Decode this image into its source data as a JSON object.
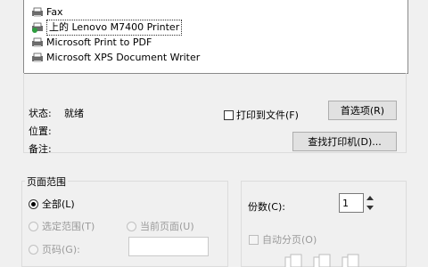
{
  "printers": [
    {
      "name": "Fax",
      "icon": "fax-printer-icon"
    },
    {
      "name": "上的 Lenovo M7400 Printer",
      "icon": "network-printer-icon",
      "selected": true
    },
    {
      "name": "Microsoft Print to PDF",
      "icon": "printer-icon"
    },
    {
      "name": "Microsoft XPS Document Writer",
      "icon": "printer-icon"
    }
  ],
  "status": {
    "status_label": "状态:",
    "status_value": "就绪",
    "location_label": "位置:",
    "comment_label": "备注:"
  },
  "print_to_file_label": "打印到文件(F)",
  "preferences_button": "首选项(R)",
  "find_printer_button": "查找打印机(D)...",
  "page_range": {
    "title": "页面范围",
    "all": "全部(L)",
    "selection": "选定范围(T)",
    "current_page": "当前页面(U)",
    "pages": "页码(G):",
    "pages_value": ""
  },
  "copies": {
    "label": "份数(C):",
    "value": "1",
    "collate_label": "自动分页(O)"
  },
  "colors": {
    "window_bg": "#f0f0f0",
    "list_bg": "#ffffff",
    "button_bg": "#e1e1e1",
    "disabled_text": "#9a9a9a"
  }
}
